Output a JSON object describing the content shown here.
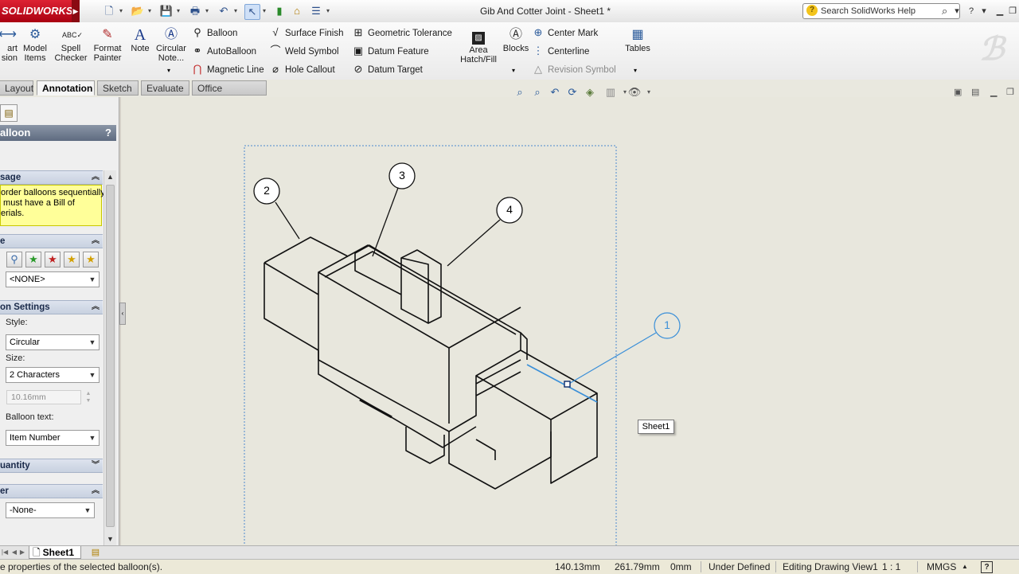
{
  "app": {
    "logo": "SOLIDWORKS",
    "document_title": "Gib And Cotter Joint - Sheet1 *"
  },
  "quick_access": [
    "new-icon",
    "open-icon",
    "save-icon",
    "print-icon",
    "undo-icon",
    "select-icon",
    "rebuild-icon",
    "file-properties-icon",
    "options-icon"
  ],
  "search": {
    "placeholder": "Search SolidWorks Help"
  },
  "command_manager": {
    "big_buttons": [
      {
        "label": "art\nsion",
        "icon": "smart-dimension-icon"
      },
      {
        "label": "Model\nItems",
        "icon": "model-items-icon"
      },
      {
        "label": "Spell\nChecker",
        "icon": "spell-checker-icon"
      },
      {
        "label": "Format\nPainter",
        "icon": "format-painter-icon"
      },
      {
        "label": "Note",
        "icon": "note-icon"
      },
      {
        "label": "Circular\nNote...",
        "icon": "circular-note-icon"
      }
    ],
    "col1": [
      "Balloon",
      "AutoBalloon",
      "Magnetic Line"
    ],
    "col2": [
      "Surface Finish",
      "Weld Symbol",
      "Hole Callout"
    ],
    "col3": [
      "Geometric Tolerance",
      "Datum Feature",
      "Datum Target"
    ],
    "area_hatch": "Area\nHatch/Fill",
    "blocks": "Blocks",
    "col4": [
      "Center Mark",
      "Centerline",
      "Revision Symbol"
    ],
    "tables": "Tables"
  },
  "tabs": [
    "Layout",
    "Annotation",
    "Sketch",
    "Evaluate",
    "Office Products"
  ],
  "active_tab": "Annotation",
  "property_manager": {
    "title": "alloon",
    "help": "?",
    "message_header": "sage",
    "message_text": "order balloons sequentially,\n must have a Bill of\nerials.",
    "style_header": "e",
    "style_value": "<NONE>",
    "balloon_settings_header": "on Settings",
    "style_label": "Style:",
    "style_select": "Circular",
    "size_label": "Size:",
    "size_select": "2 Characters",
    "size_value": "10.16mm",
    "balloon_text_label": "Balloon text:",
    "balloon_text_select": "Item Number",
    "quantity_header": "uantity",
    "layer_header": "er",
    "layer_select": "-None-"
  },
  "drawing": {
    "balloons": [
      "1",
      "2",
      "3",
      "4"
    ],
    "sheet_popup": "Sheet1"
  },
  "sheet_tabs": {
    "active": "Sheet1"
  },
  "status": {
    "hint": "e properties of the selected balloon(s).",
    "x": "140.13mm",
    "y": "261.79mm",
    "z": "0mm",
    "state": "Under Defined",
    "mode": "Editing Drawing View1",
    "scale": "1 : 1",
    "units": "MMGS"
  },
  "colors": {
    "accent_blue": "#3a8fd8",
    "message_yellow": "#ffff99",
    "canvas": "#e8e7dd"
  }
}
